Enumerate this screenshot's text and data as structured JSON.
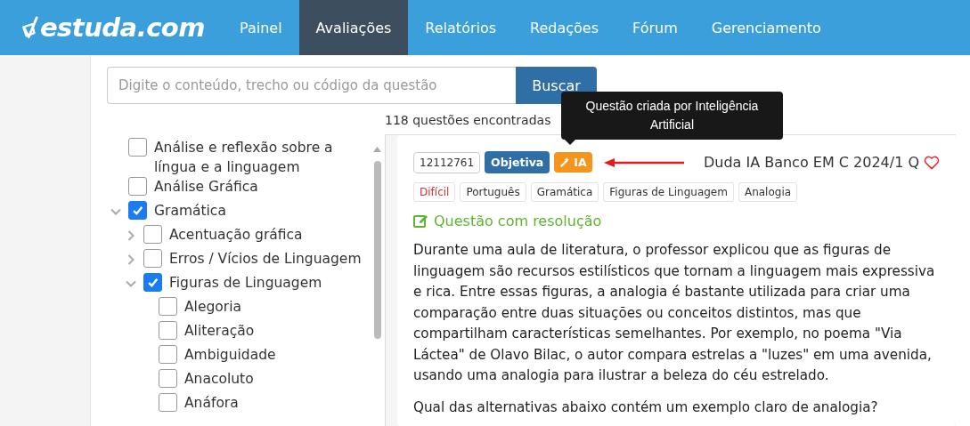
{
  "nav": {
    "items": [
      {
        "label": "Painel",
        "selected": false
      },
      {
        "label": "Avaliações",
        "selected": true
      },
      {
        "label": "Relatórios",
        "selected": false
      },
      {
        "label": "Redações",
        "selected": false
      },
      {
        "label": "Fórum",
        "selected": false
      },
      {
        "label": "Gerenciamento",
        "selected": false
      }
    ],
    "logo": "estuda.com"
  },
  "search": {
    "placeholder": "Digite o conteúdo, trecho ou código da questão",
    "button": "Buscar"
  },
  "tree": [
    {
      "label": "Análise e reflexão sobre a língua e a linguagem",
      "checked": false
    },
    {
      "label": "Análise Gráfica",
      "checked": false
    },
    {
      "label": "Gramática",
      "checked": true,
      "expanded": true,
      "children": [
        {
          "label": "Acentuação gráfica",
          "checked": false,
          "expanded": false
        },
        {
          "label": "Erros / Vícios de Linguagem",
          "checked": false,
          "expanded": false
        },
        {
          "label": "Figuras de Linguagem",
          "checked": true,
          "expanded": true,
          "children": [
            {
              "label": "Alegoria",
              "checked": false
            },
            {
              "label": "Aliteração",
              "checked": false
            },
            {
              "label": "Ambiguidade",
              "checked": false
            },
            {
              "label": "Anacoluto",
              "checked": false
            },
            {
              "label": "Anáfora",
              "checked": false
            }
          ]
        }
      ]
    }
  ],
  "results_count": "118 questões encontradas",
  "tooltip": "Questão criada por Inteligência Artificial",
  "question": {
    "code": "12112761",
    "type": "Objetiva",
    "ai_badge": "IA",
    "source": "Duda IA Banco EM C 2024/1 Q",
    "favorite": false,
    "tags": [
      {
        "label": "Difícil",
        "color": "#d9302c"
      },
      {
        "label": "Português",
        "color": "#333333"
      },
      {
        "label": "Gramática",
        "color": "#333333"
      },
      {
        "label": "Figuras de Linguagem",
        "color": "#333333"
      },
      {
        "label": "Analogia",
        "color": "#333333"
      }
    ],
    "resolution": "Questão com resolução",
    "text": "Durante uma aula de literatura, o professor explicou que as figuras de linguagem são recursos estilísticos que tornam a linguagem mais expressiva e rica. Entre essas figuras, a analogia é bastante utilizada para criar uma comparação entre duas situações ou conceitos distintos, mas que compartilham características semelhantes. Por exemplo, no poema \"Via Láctea\" de Olavo Bilac, o autor compara estrelas a \"luzes\" em uma avenida, usando uma analogia para ilustrar a beleza do céu estrelado.",
    "prompt": "Qual das alternativas abaixo contém um exemplo claro de analogia?"
  }
}
